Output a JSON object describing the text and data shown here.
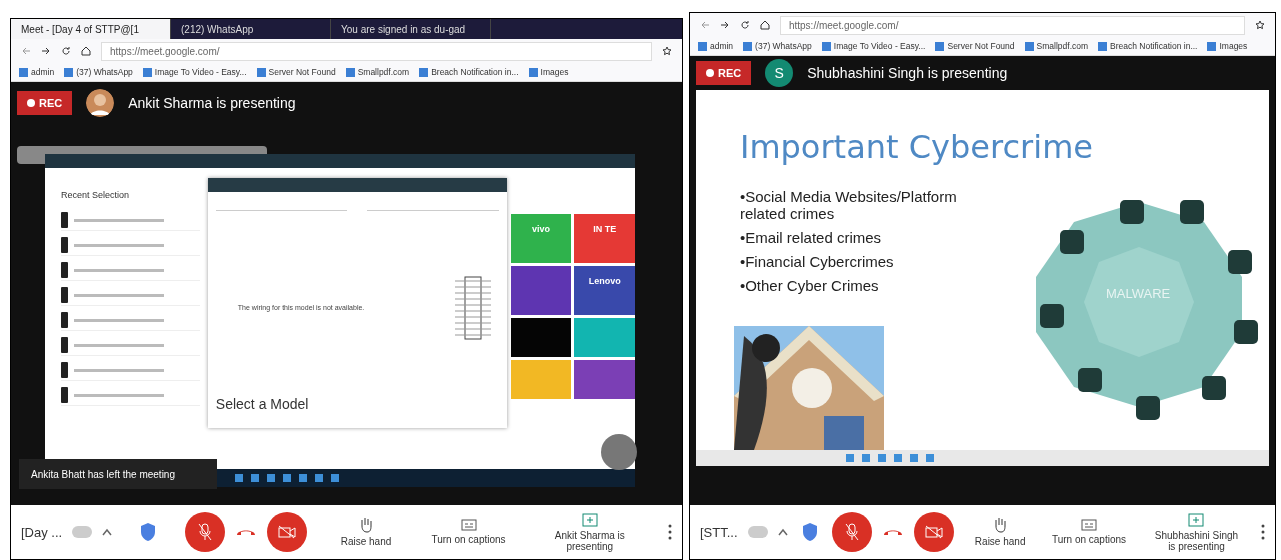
{
  "meetings": [
    {
      "browser": {
        "tabs": [
          {
            "label": "Meet - [Day 4 of STTP@[1",
            "selected": true
          },
          {
            "label": "(212) WhatsApp",
            "selected": false
          },
          {
            "label": "You are signed in as du-gad",
            "selected": false
          }
        ],
        "url": "https://meet.google.com/",
        "bookmarks": [
          "admin",
          "(37) WhatsApp",
          "Image To Video - Easy...",
          "Server Not Found",
          "Smallpdf.com",
          "Breach Notification in...",
          "Images"
        ]
      },
      "rec": "REC",
      "presenter": {
        "text": "Ankit Sharma is presenting"
      },
      "content": {
        "kind": "app",
        "sidebar_title": "Recent Selection",
        "dialog_message": "The wiring for this model is not available.",
        "dialog_heading": "Select a Model",
        "tiles": [
          {
            "label": "vivo",
            "color": "#2fb24c"
          },
          {
            "label": "IN TE",
            "color": "#e53935"
          },
          {
            "color": "#5e35b1"
          },
          {
            "label": "Lenovo",
            "color": "#3949ab"
          },
          {
            "color": "#050505"
          },
          {
            "color": "#12b5b0"
          },
          {
            "color": "#f2b824"
          },
          {
            "color": "#7b3fb5"
          }
        ],
        "toast": "Ankita Bhatt has left the meeting"
      },
      "controls": {
        "meeting_name": "[Day ...",
        "mic_on": false,
        "camera_on": false,
        "raise_hand": "Raise hand",
        "captions": "Turn on captions",
        "presenting": "Ankit Sharma is presenting"
      }
    },
    {
      "browser": {
        "url": "https://meet.google.com/",
        "bookmarks": [
          "admin",
          "(37) WhatsApp",
          "Image To Video - Easy...",
          "Server Not Found",
          "Smallpdf.com",
          "Breach Notification in...",
          "Images"
        ]
      },
      "rec": "REC",
      "presenter": {
        "kind": "letter",
        "initial": "S",
        "text": "Shubhashini Singh is presenting"
      },
      "content": {
        "kind": "slide",
        "title": "Important Cybercrime",
        "bullets": [
          "•Social Media Websites/Platform related crimes",
          "•Email related crimes",
          "•Financial Cybercrimes",
          "•Other Cyber Crimes"
        ],
        "diagram_label": "MALWARE"
      },
      "controls": {
        "meeting_name": "[STT...",
        "mic_on": false,
        "camera_on": false,
        "raise_hand": "Raise hand",
        "captions": "Turn on captions",
        "presenting": "Shubhashini Singh is presenting"
      }
    }
  ]
}
